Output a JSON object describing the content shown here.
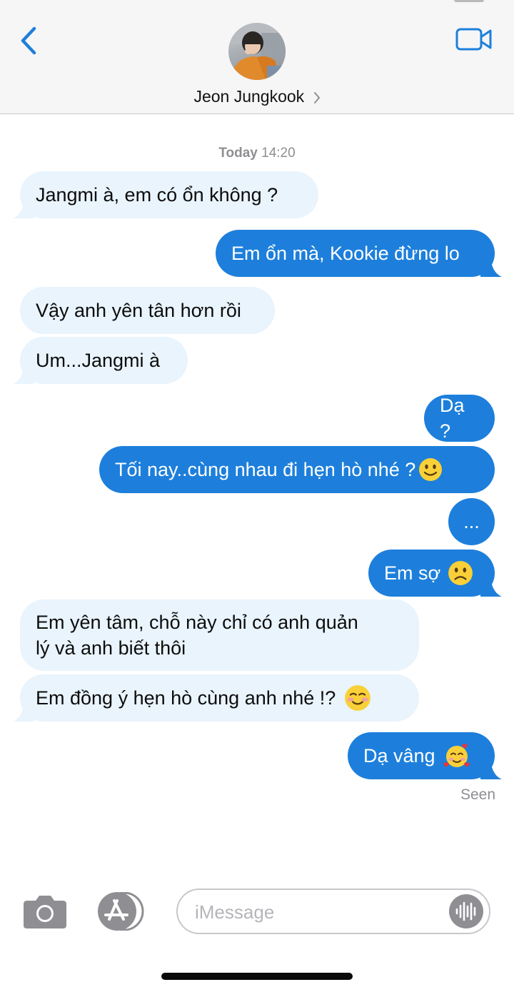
{
  "header": {
    "contact_name": "Jeon Jungkook",
    "back_icon": "chevron-left-icon",
    "video_icon": "video-camera-icon",
    "accent_color": "#1d7fdb"
  },
  "thread": {
    "timestamp_day": "Today",
    "timestamp_time": "14:20",
    "messages": [
      {
        "direction": "incoming",
        "text": "Jangmi à, em có ổn không ?"
      },
      {
        "direction": "outgoing",
        "text": "Em ổn mà, Kookie đừng lo"
      },
      {
        "direction": "incoming",
        "text": "Vậy anh yên tân hơn rồi"
      },
      {
        "direction": "incoming",
        "text": "Um...Jangmi à"
      },
      {
        "direction": "outgoing",
        "text": "Dạ ?"
      },
      {
        "direction": "outgoing",
        "text": "Tối nay..cùng nhau đi hẹn hò nhé ?",
        "emoji": "slightly-smiling-face"
      },
      {
        "direction": "outgoing",
        "text": "..."
      },
      {
        "direction": "outgoing",
        "text": "Em sợ",
        "emoji": "frowning-face"
      },
      {
        "direction": "incoming",
        "text_line1": "Em yên tâm, chỗ này chỉ có anh quản",
        "text_line2": "lý và anh biết thôi"
      },
      {
        "direction": "incoming",
        "text": "Em đồng ý hẹn hò cùng anh nhé !?",
        "emoji": "smiling-face"
      },
      {
        "direction": "outgoing",
        "text": "Dạ vâng",
        "emoji": "smiling-face-with-hearts"
      }
    ],
    "seen_label": "Seen",
    "incoming_color": "#e9f4fd",
    "outgoing_color": "#1d7fdb"
  },
  "composer": {
    "placeholder": "iMessage",
    "camera_icon": "camera-icon",
    "appstore_icon": "app-store-icon",
    "audio_icon": "audio-waveform-icon"
  }
}
